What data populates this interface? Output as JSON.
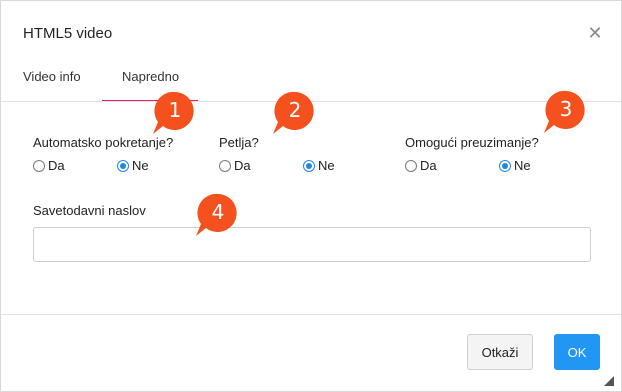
{
  "dialog": {
    "title": "HTML5 video",
    "close_icon": "close-icon"
  },
  "tabs": [
    {
      "label": "Video info",
      "active": false
    },
    {
      "label": "Napredno",
      "active": true
    }
  ],
  "options": {
    "autoplay": {
      "label": "Automatsko pokretanje?",
      "yes": "Da",
      "no": "Ne",
      "selected": "Ne"
    },
    "loop": {
      "label": "Petlja?",
      "yes": "Da",
      "no": "Ne",
      "selected": "Ne"
    },
    "download": {
      "label": "Omogući preuzimanje?",
      "yes": "Da",
      "no": "Ne",
      "selected": "Ne"
    }
  },
  "tooltip": {
    "label": "Savetodavni naslov",
    "value": ""
  },
  "footer": {
    "cancel_label": "Otkaži",
    "ok_label": "OK"
  },
  "callouts": [
    "1",
    "2",
    "3",
    "4"
  ],
  "colors": {
    "accent_tab": "#e91e63",
    "primary": "#2196f3",
    "callout": "#f4511e"
  }
}
